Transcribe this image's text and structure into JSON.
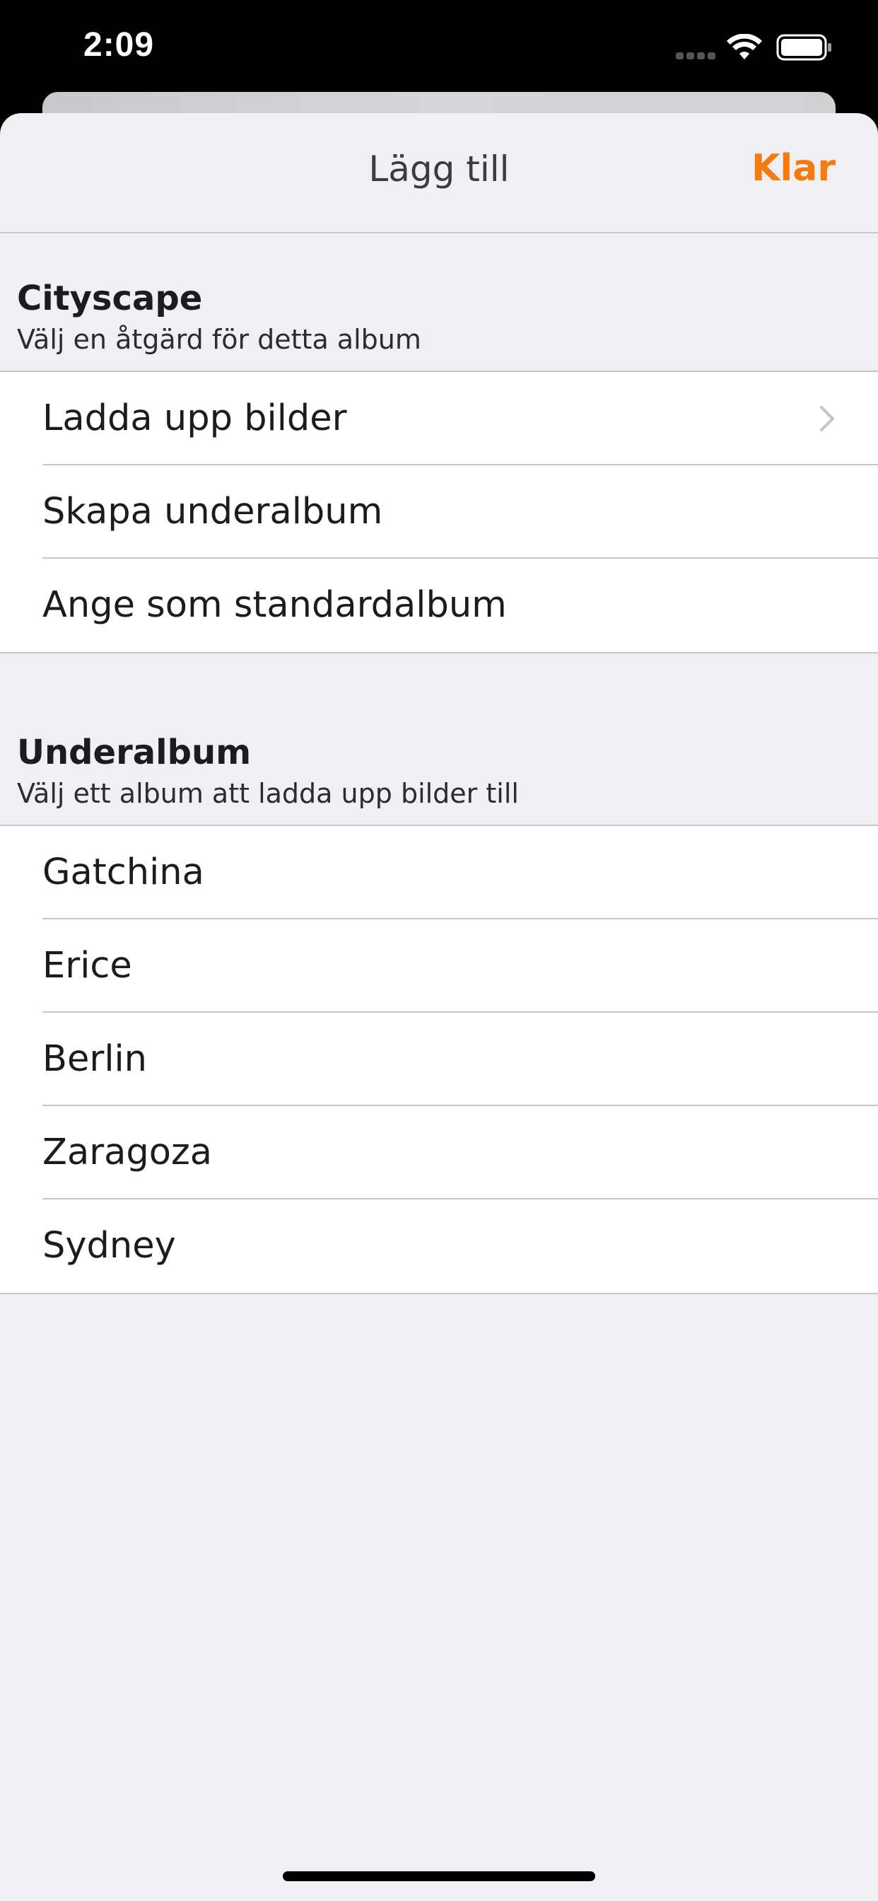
{
  "status_bar": {
    "time": "2:09",
    "icons": [
      "signal-icon",
      "wifi-icon",
      "battery-icon"
    ]
  },
  "nav": {
    "title": "Lägg till",
    "done_label": "Klar"
  },
  "album_section": {
    "title": "Cityscape",
    "subtitle": "Välj en åtgärd för detta album",
    "items": [
      {
        "label": "Ladda upp bilder",
        "has_chevron": true
      },
      {
        "label": "Skapa underalbum",
        "has_chevron": false
      },
      {
        "label": "Ange som standardalbum",
        "has_chevron": false
      }
    ]
  },
  "subalbum_section": {
    "title": "Underalbum",
    "subtitle": "Välj ett album att ladda upp bilder till",
    "items": [
      {
        "label": "Gatchina"
      },
      {
        "label": "Erice"
      },
      {
        "label": "Berlin"
      },
      {
        "label": "Zaragoza"
      },
      {
        "label": "Sydney"
      }
    ]
  },
  "colors": {
    "accent": "#f47b10",
    "background": "#efeff4",
    "cell_background": "#ffffff",
    "separator": "#c8c7cc"
  }
}
